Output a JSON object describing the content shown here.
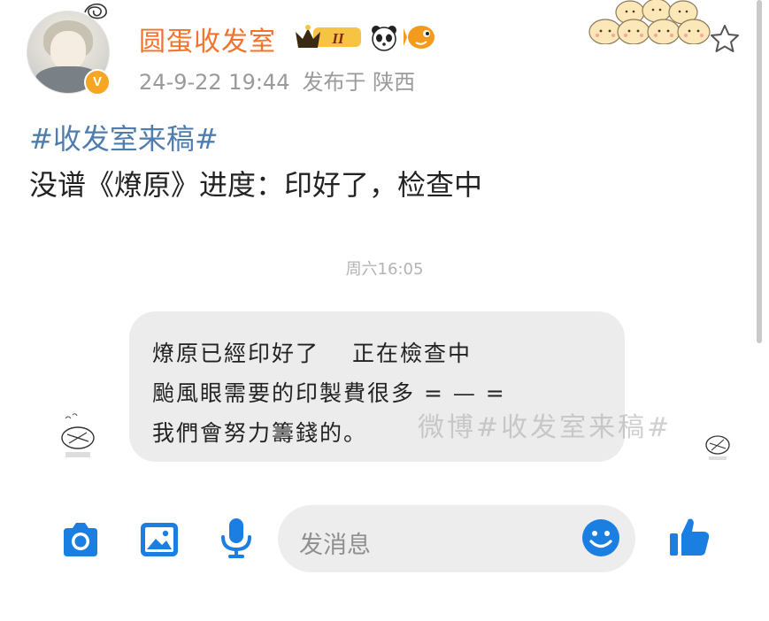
{
  "post": {
    "username": "圆蛋收发室",
    "vip_level": "II",
    "timestamp": "24-9-22 19:44",
    "location": "发布于 陕西",
    "verified_badge": "V",
    "topic": "#收发室来稿#",
    "content": "没谱《燎原》进度：印好了，检查中"
  },
  "chat": {
    "time": "周六16:05",
    "message_lines": [
      "燎原已經印好了　 正在檢查中",
      "颱風眼需要的印製費很多 = — =",
      "我們會努力籌錢的。"
    ],
    "watermark": "微博#收发室来稿#"
  },
  "input_bar": {
    "placeholder": "发消息",
    "icons": [
      "camera-icon",
      "image-icon",
      "microphone-icon",
      "smile-icon",
      "thumbs-up-icon"
    ]
  },
  "colors": {
    "username": "#f3722c",
    "topic": "#507daf",
    "accent_blue": "#1a7fe0",
    "meta": "#9a9a9a"
  }
}
